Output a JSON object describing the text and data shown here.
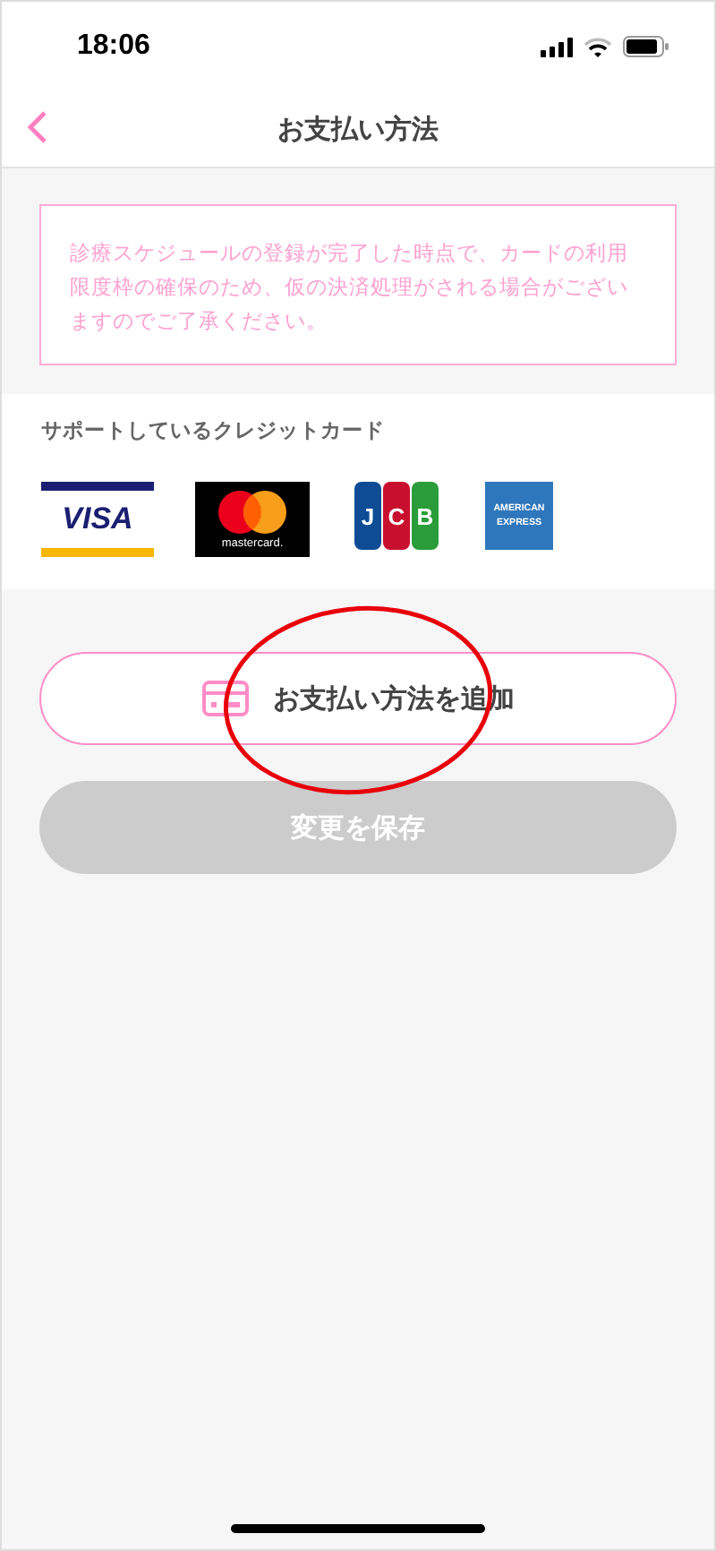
{
  "status_bar": {
    "time": "18:06"
  },
  "nav": {
    "title": "お支払い方法"
  },
  "notice": {
    "text": "診療スケジュールの登録が完了した時点で、カードの利用限度枠の確保のため、仮の決済処理がされる場合がございますのでご了承ください。"
  },
  "supported_cards": {
    "heading": "サポートしているクレジットカード",
    "cards": [
      {
        "kind": "visa",
        "lines": [
          "VISA"
        ]
      },
      {
        "kind": "mastercard",
        "lines": [
          "mastercard."
        ]
      },
      {
        "kind": "jcb",
        "lines": [
          "J",
          "C",
          "B"
        ]
      },
      {
        "kind": "amex",
        "lines": [
          "AMERICAN",
          "EXPRESS"
        ]
      }
    ]
  },
  "buttons": [
    {
      "kind": "add",
      "label": "お支払い方法を追加",
      "disabled": false
    },
    {
      "kind": "save",
      "label": "変更を保存",
      "disabled": true
    }
  ],
  "annotation": {
    "kind": "ellipse"
  }
}
